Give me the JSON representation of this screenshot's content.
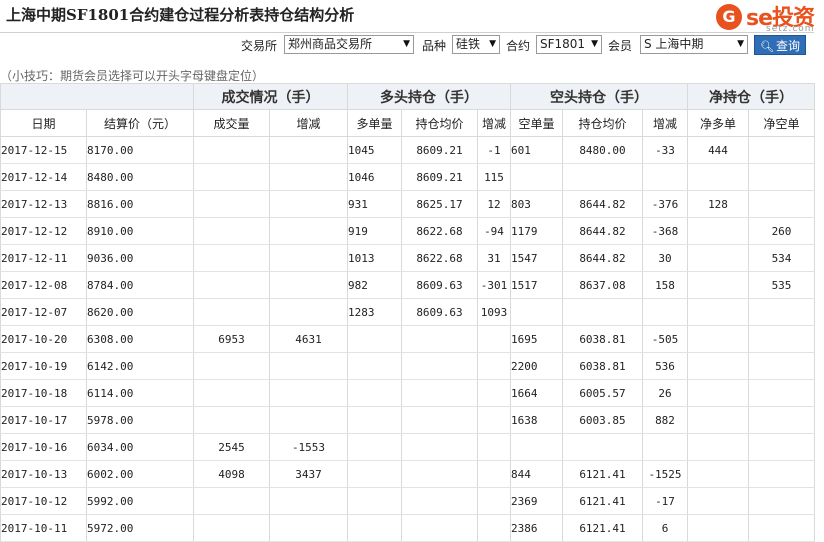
{
  "title": "上海中期SF1801合约建仓过程分析表持仓结构分析",
  "logo": {
    "brand": "se投资",
    "glyph": "G",
    "domain": "setz.com",
    "color": "#e8521e"
  },
  "filters": {
    "exchange_label": "交易所",
    "exchange_value": "郑州商品交易所",
    "variety_label": "品种",
    "variety_value": "硅铁",
    "contract_label": "合约",
    "contract_value": "SF1801",
    "member_label": "会员",
    "member_value": "S 上海中期",
    "query_label": "查询",
    "query_icon": "search-icon"
  },
  "tip": "（小技巧：期货会员选择可以开头字母键盘定位）",
  "table": {
    "group_headers": [
      "成交情况（手）",
      "多头持仓（手）",
      "空头持仓（手）",
      "净持仓（手）"
    ],
    "columns": [
      "日期",
      "结算价（元）",
      "成交量",
      "增减",
      "多单量",
      "持仓均价",
      "增减",
      "空单量",
      "持仓均价",
      "增减",
      "净多单",
      "净空单"
    ],
    "rows": [
      {
        "date": "2017-12-15",
        "price": "8170.00",
        "vol": "",
        "vol_chg": "",
        "long": "1045",
        "long_avg": "8609.21",
        "long_chg": "-1",
        "short": "601",
        "short_avg": "8480.00",
        "short_chg": "-33",
        "net_long": "444",
        "net_short": ""
      },
      {
        "date": "2017-12-14",
        "price": "8480.00",
        "vol": "",
        "vol_chg": "",
        "long": "1046",
        "long_avg": "8609.21",
        "long_chg": "115",
        "short": "",
        "short_avg": "",
        "short_chg": "",
        "net_long": "",
        "net_short": ""
      },
      {
        "date": "2017-12-13",
        "price": "8816.00",
        "vol": "",
        "vol_chg": "",
        "long": "931",
        "long_avg": "8625.17",
        "long_chg": "12",
        "short": "803",
        "short_avg": "8644.82",
        "short_chg": "-376",
        "net_long": "128",
        "net_short": ""
      },
      {
        "date": "2017-12-12",
        "price": "8910.00",
        "vol": "",
        "vol_chg": "",
        "long": "919",
        "long_avg": "8622.68",
        "long_chg": "-94",
        "short": "1179",
        "short_avg": "8644.82",
        "short_chg": "-368",
        "net_long": "",
        "net_short": "260"
      },
      {
        "date": "2017-12-11",
        "price": "9036.00",
        "vol": "",
        "vol_chg": "",
        "long": "1013",
        "long_avg": "8622.68",
        "long_chg": "31",
        "short": "1547",
        "short_avg": "8644.82",
        "short_chg": "30",
        "net_long": "",
        "net_short": "534"
      },
      {
        "date": "2017-12-08",
        "price": "8784.00",
        "vol": "",
        "vol_chg": "",
        "long": "982",
        "long_avg": "8609.63",
        "long_chg": "-301",
        "short": "1517",
        "short_avg": "8637.08",
        "short_chg": "158",
        "net_long": "",
        "net_short": "535"
      },
      {
        "date": "2017-12-07",
        "price": "8620.00",
        "vol": "",
        "vol_chg": "",
        "long": "1283",
        "long_avg": "8609.63",
        "long_chg": "1093",
        "short": "",
        "short_avg": "",
        "short_chg": "",
        "net_long": "",
        "net_short": ""
      },
      {
        "date": "2017-10-20",
        "price": "6308.00",
        "vol": "6953",
        "vol_chg": "4631",
        "long": "",
        "long_avg": "",
        "long_chg": "",
        "short": "1695",
        "short_avg": "6038.81",
        "short_chg": "-505",
        "net_long": "",
        "net_short": ""
      },
      {
        "date": "2017-10-19",
        "price": "6142.00",
        "vol": "",
        "vol_chg": "",
        "long": "",
        "long_avg": "",
        "long_chg": "",
        "short": "2200",
        "short_avg": "6038.81",
        "short_chg": "536",
        "net_long": "",
        "net_short": ""
      },
      {
        "date": "2017-10-18",
        "price": "6114.00",
        "vol": "",
        "vol_chg": "",
        "long": "",
        "long_avg": "",
        "long_chg": "",
        "short": "1664",
        "short_avg": "6005.57",
        "short_chg": "26",
        "net_long": "",
        "net_short": ""
      },
      {
        "date": "2017-10-17",
        "price": "5978.00",
        "vol": "",
        "vol_chg": "",
        "long": "",
        "long_avg": "",
        "long_chg": "",
        "short": "1638",
        "short_avg": "6003.85",
        "short_chg": "882",
        "net_long": "",
        "net_short": ""
      },
      {
        "date": "2017-10-16",
        "price": "6034.00",
        "vol": "2545",
        "vol_chg": "-1553",
        "long": "",
        "long_avg": "",
        "long_chg": "",
        "short": "",
        "short_avg": "",
        "short_chg": "",
        "net_long": "",
        "net_short": ""
      },
      {
        "date": "2017-10-13",
        "price": "6002.00",
        "vol": "4098",
        "vol_chg": "3437",
        "long": "",
        "long_avg": "",
        "long_chg": "",
        "short": "844",
        "short_avg": "6121.41",
        "short_chg": "-1525",
        "net_long": "",
        "net_short": ""
      },
      {
        "date": "2017-10-12",
        "price": "5992.00",
        "vol": "",
        "vol_chg": "",
        "long": "",
        "long_avg": "",
        "long_chg": "",
        "short": "2369",
        "short_avg": "6121.41",
        "short_chg": "-17",
        "net_long": "",
        "net_short": ""
      },
      {
        "date": "2017-10-11",
        "price": "5972.00",
        "vol": "",
        "vol_chg": "",
        "long": "",
        "long_avg": "",
        "long_chg": "",
        "short": "2386",
        "short_avg": "6121.41",
        "short_chg": "6",
        "net_long": "",
        "net_short": ""
      }
    ]
  },
  "colors": {
    "increase": "#d42020",
    "decrease": "#2a9a2a",
    "header_bg": "#eef2f7",
    "button_bg": "#2f6db5"
  }
}
